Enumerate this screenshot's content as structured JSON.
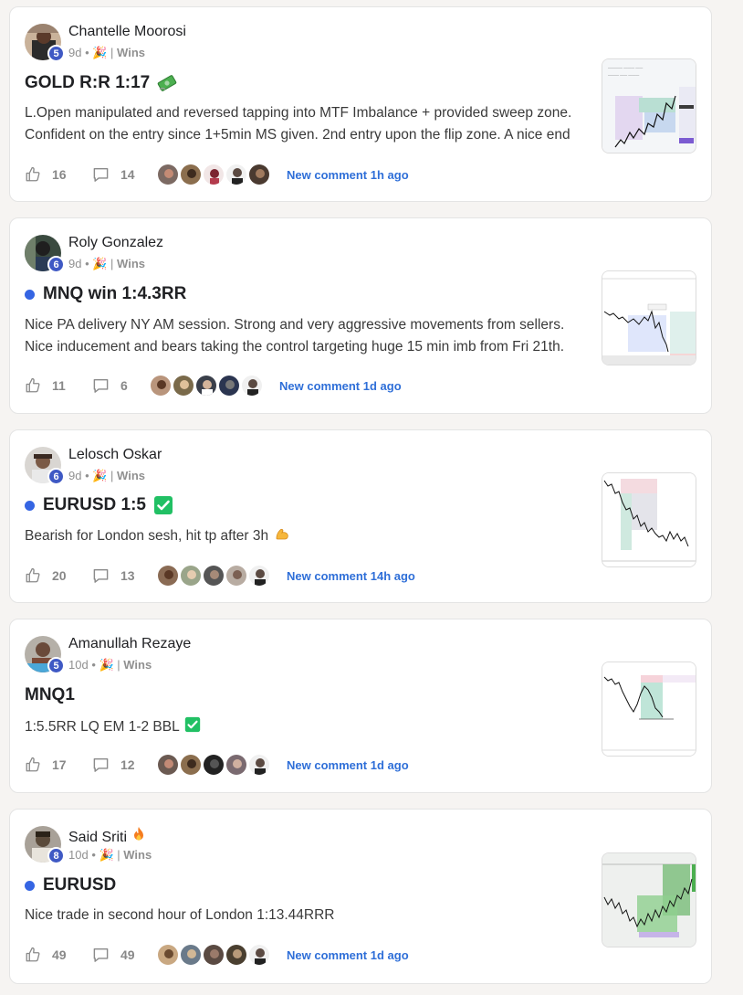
{
  "posts": [
    {
      "author": "Chantelle Moorosi",
      "level": "5",
      "time": "9d",
      "category": "Wins",
      "title": "GOLD R:R 1:17",
      "title_emoji": "money-with-wings-icon",
      "has_dot": false,
      "body": "L.Open manipulated and reversed tapping into MTF Imbalance + provided sweep zone. Confident on the entry since 1+5min MS given. 2nd entry upon the flip zone. A nice end",
      "likes": "16",
      "comments": "14",
      "new_comment": "New comment 1h ago"
    },
    {
      "author": "Roly Gonzalez",
      "level": "6",
      "time": "9d",
      "category": "Wins",
      "title": "MNQ win 1:4.3RR",
      "has_dot": true,
      "body": "Nice PA delivery NY AM session. Strong and very aggressive movements from sellers. Nice inducement and bears taking the control targeting huge 15 min imb from Fri 21th.",
      "likes": "11",
      "comments": "6",
      "new_comment": "New comment 1d ago"
    },
    {
      "author": "Lelosch Oskar",
      "level": "6",
      "time": "9d",
      "category": "Wins",
      "title": "EURUSD 1:5",
      "title_emoji": "check-mark-button-icon",
      "has_dot": true,
      "body": "Bearish for London sesh, hit tp after 3h",
      "body_emoji": "flexed-biceps-icon",
      "likes": "20",
      "comments": "13",
      "new_comment": "New comment 14h ago"
    },
    {
      "author": "Amanullah Rezaye",
      "level": "5",
      "time": "10d",
      "category": "Wins",
      "title": "MNQ1",
      "has_dot": false,
      "body": "1:5.5RR LQ EM 1-2 BBL",
      "body_emoji": "check-mark-button-icon",
      "likes": "17",
      "comments": "12",
      "new_comment": "New comment 1d ago"
    },
    {
      "author": "Said Sriti",
      "author_emoji": "fire-icon",
      "level": "8",
      "time": "10d",
      "category": "Wins",
      "title": "EURUSD",
      "has_dot": true,
      "body": "Nice trade in second hour of London 1:13.44RRR",
      "likes": "49",
      "comments": "49",
      "new_comment": "New comment 1d ago"
    }
  ],
  "colors": {
    "accent_blue": "#2f6fd8",
    "level_badge": "#3f59c4",
    "dot_blue": "#3565e3"
  }
}
